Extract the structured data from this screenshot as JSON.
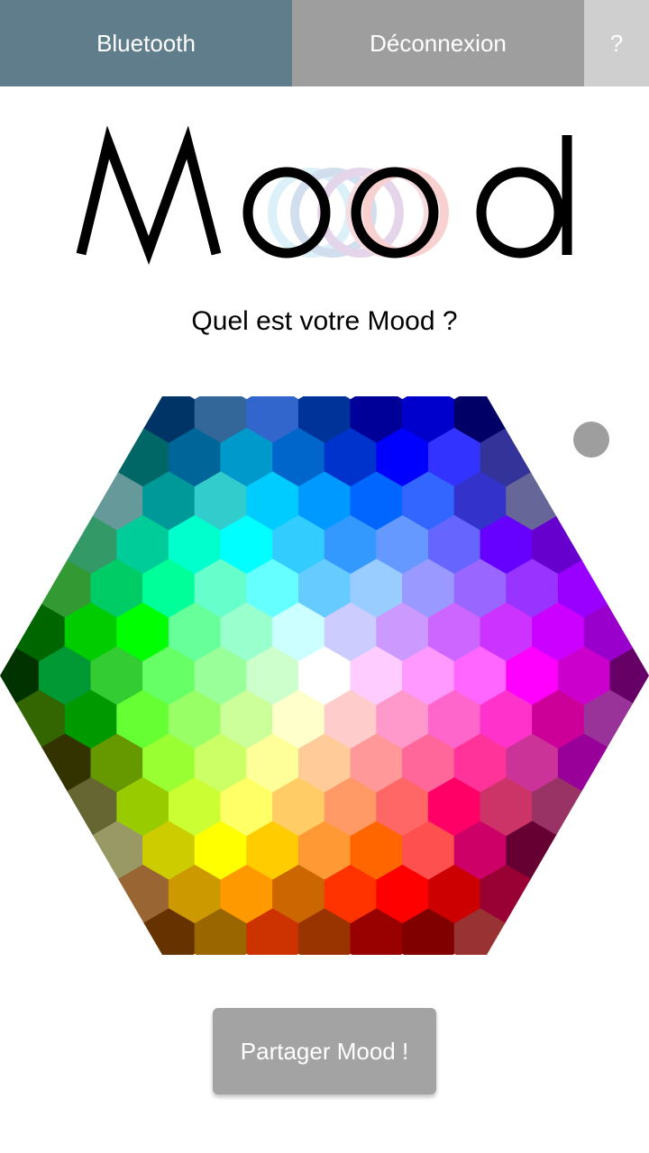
{
  "topbar": {
    "bluetooth_label": "Bluetooth",
    "disconnect_label": "Déconnexion",
    "help_label": "?"
  },
  "logo": {
    "text": "Mood"
  },
  "question": "Quel est votre Mood ?",
  "share_label": "Partager Mood !",
  "colors": {
    "bluetooth_bg": "#607d8b",
    "disconnect_bg": "#9e9e9e",
    "help_bg": "#cfcfcf",
    "share_bg": "#a3a3a3"
  },
  "palette": [
    [
      "#003366",
      "#336699",
      "#3366cc",
      "#003399",
      "#000099",
      "#0000cc",
      "#000066"
    ],
    [
      "#006666",
      "#006699",
      "#0099cc",
      "#0066cc",
      "#0033cc",
      "#0000ff",
      "#3333ff",
      "#333399"
    ],
    [
      "#669999",
      "#009999",
      "#33cccc",
      "#00ccff",
      "#0099ff",
      "#0066ff",
      "#3366ff",
      "#3333cc",
      "#666699"
    ],
    [
      "#339966",
      "#00cc99",
      "#00ffcc",
      "#00ffff",
      "#33ccff",
      "#3399ff",
      "#6699ff",
      "#6666ff",
      "#6600ff",
      "#6600cc"
    ],
    [
      "#339933",
      "#00cc66",
      "#00ff99",
      "#66ffcc",
      "#66ffff",
      "#66ccff",
      "#99ccff",
      "#9999ff",
      "#9966ff",
      "#9933ff",
      "#9900ff"
    ],
    [
      "#006600",
      "#00cc00",
      "#00ff00",
      "#66ff99",
      "#99ffcc",
      "#ccffff",
      "#ccccff",
      "#cc99ff",
      "#cc66ff",
      "#cc33ff",
      "#cc00ff",
      "#9900cc"
    ],
    [
      "#003300",
      "#009933",
      "#33cc33",
      "#66ff66",
      "#99ff99",
      "#ccffcc",
      "#ffffff",
      "#ffccff",
      "#ff99ff",
      "#ff66ff",
      "#ff00ff",
      "#cc00cc",
      "#660066"
    ],
    [
      "#336600",
      "#009900",
      "#66ff33",
      "#99ff66",
      "#ccff99",
      "#ffffcc",
      "#ffcccc",
      "#ff99cc",
      "#ff66cc",
      "#ff33cc",
      "#cc0099",
      "#993399"
    ],
    [
      "#333300",
      "#669900",
      "#99ff33",
      "#ccff66",
      "#ffff99",
      "#ffcc99",
      "#ff9999",
      "#ff6699",
      "#ff3399",
      "#cc3399",
      "#990099"
    ],
    [
      "#666633",
      "#99cc00",
      "#ccff33",
      "#ffff66",
      "#ffcc66",
      "#ff9966",
      "#ff6666",
      "#ff0066",
      "#cc3366",
      "#993366"
    ],
    [
      "#999966",
      "#cccc00",
      "#ffff00",
      "#ffcc00",
      "#ff9933",
      "#ff6600",
      "#ff5050",
      "#cc0066",
      "#660033"
    ],
    [
      "#996633",
      "#cc9900",
      "#ff9900",
      "#cc6600",
      "#ff3300",
      "#ff0000",
      "#cc0000",
      "#990033"
    ],
    [
      "#663300",
      "#996600",
      "#cc3300",
      "#993300",
      "#990000",
      "#800000",
      "#993333"
    ]
  ]
}
